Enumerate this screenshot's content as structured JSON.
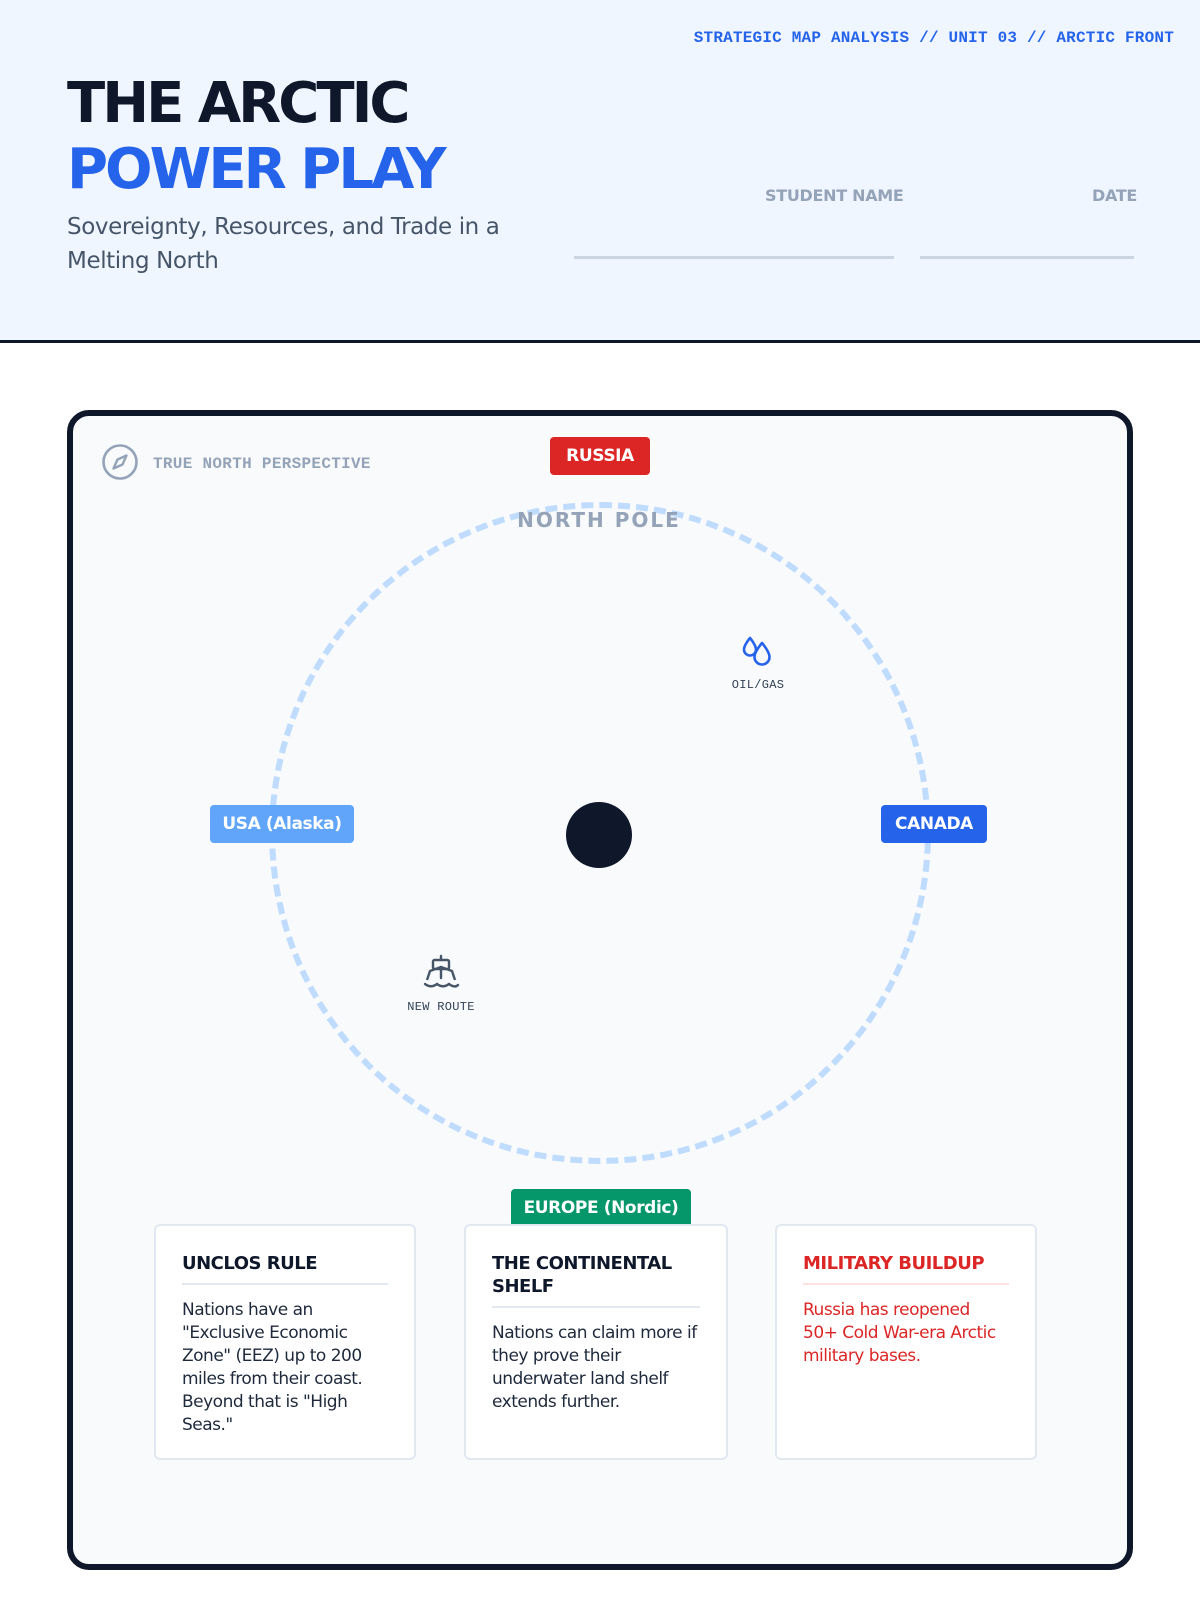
{
  "header": {
    "unit_tag": "STRATEGIC MAP ANALYSIS // UNIT 03 // ARCTIC FRONT",
    "title_line1": "THE ARCTIC",
    "title_line2": "POWER PLAY",
    "subtitle": "Sovereignty, Resources, and Trade in a Melting North",
    "student_name_label": "STUDENT NAME",
    "date_label": "DATE"
  },
  "map": {
    "perspective_label": "TRUE NORTH PERSPECTIVE",
    "pole_label": "NORTH POLE",
    "nations": {
      "russia": "RUSSIA",
      "usa": "USA (Alaska)",
      "canada": "CANADA",
      "europe": "EUROPE (Nordic)"
    },
    "markers": {
      "oil_gas": "OIL/GAS",
      "new_route": "NEW ROUTE"
    },
    "icons": [
      "compass-icon",
      "oil-drops-icon",
      "ship-icon"
    ]
  },
  "cards": [
    {
      "title": "UNCLOS RULE",
      "body": "Nations have an \"Exclusive Economic Zone\" (EEZ) up to 200 miles from their coast. Beyond that is \"High Seas.\""
    },
    {
      "title": "THE CONTINENTAL SHELF",
      "body": "Nations can claim more if they prove their underwater land shelf extends further."
    },
    {
      "title": "MILITARY BUILDUP",
      "body": "Russia has reopened 50+ Cold War-era Arctic military bases."
    }
  ],
  "colors": {
    "ink": "#0f172a",
    "accent_blue": "#2563eb",
    "russia_red": "#dc2626",
    "usa_lightblue": "#60a5fa",
    "europe_green": "#059669",
    "ring_blue": "#bfdbfe",
    "header_bg": "#eff6ff"
  }
}
